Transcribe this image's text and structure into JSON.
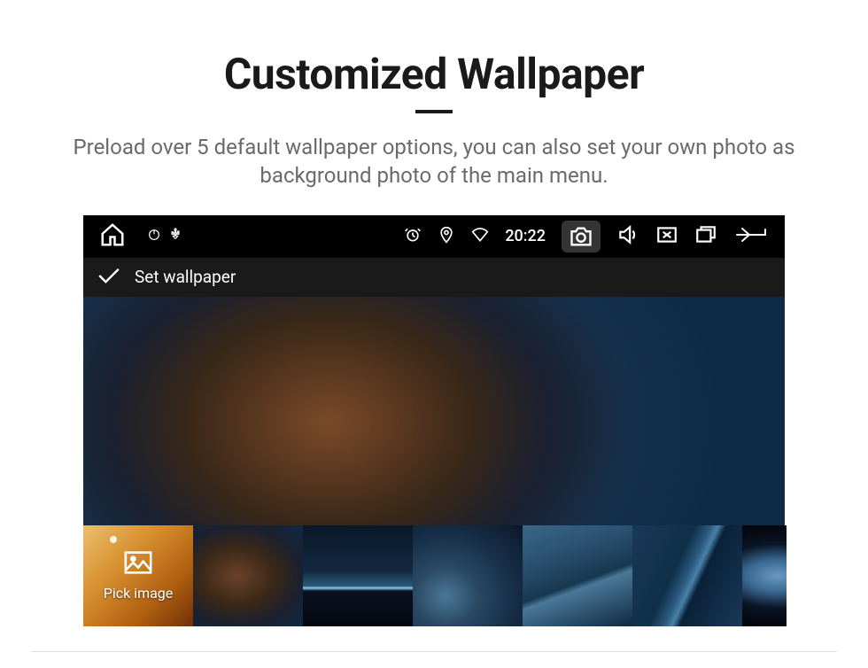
{
  "header": {
    "title": "Customized Wallpaper",
    "subtitle": "Preload over 5 default wallpaper options, you can also set your own photo as background photo of the main menu."
  },
  "statusbar": {
    "time": "20:22"
  },
  "actionbar": {
    "label": "Set wallpaper"
  },
  "thumbnails": {
    "pick_label": "Pick image"
  }
}
